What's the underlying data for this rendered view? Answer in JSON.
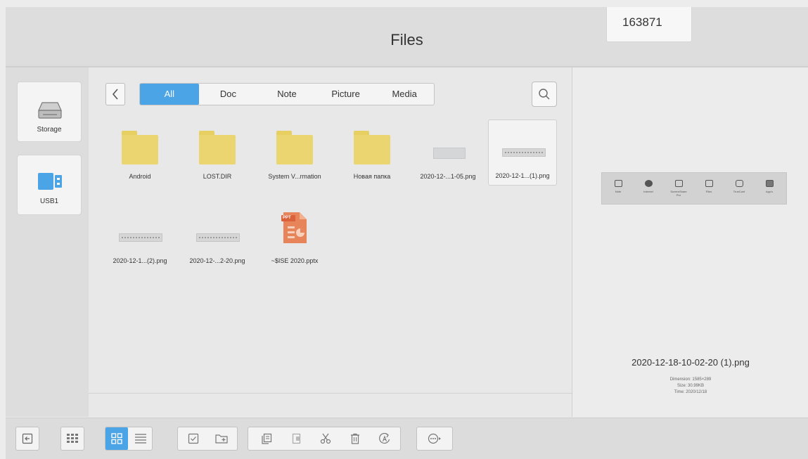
{
  "header": {
    "title": "Files",
    "badge": "163871"
  },
  "sidebar": {
    "devices": [
      {
        "label": "Storage"
      },
      {
        "label": "USB1"
      }
    ]
  },
  "filter": {
    "tabs": [
      "All",
      "Doc",
      "Note",
      "Picture",
      "Media"
    ],
    "active": "All"
  },
  "files": [
    {
      "name": "Android",
      "kind": "folder"
    },
    {
      "name": "LOST.DIR",
      "kind": "folder"
    },
    {
      "name": "System V...rmation",
      "kind": "folder"
    },
    {
      "name": "Новая папка",
      "kind": "folder"
    },
    {
      "name": "2020-12-...1-05.png",
      "kind": "image"
    },
    {
      "name": "2020-12-1...(1).png",
      "kind": "image",
      "selected": true
    },
    {
      "name": "2020-12-1...(2).png",
      "kind": "image"
    },
    {
      "name": "2020-12-...2-20.png",
      "kind": "image"
    },
    {
      "name": "~$ISE 2020.pptx",
      "kind": "ppt",
      "badge": "PPT"
    }
  ],
  "preview": {
    "filename": "2020-12-18-10-02-20 (1).png",
    "dimension": "Dimension: 1585×289",
    "size": "Size: 30.99KB",
    "time": "Time: 2020/12/18",
    "icons": [
      {
        "label": "Note",
        "icon": "board-icon"
      },
      {
        "label": "Internet",
        "icon": "globe-icon"
      },
      {
        "label": "ScreenShare Pro",
        "icon": "cast-icon"
      },
      {
        "label": "Files",
        "icon": "folder-icon"
      },
      {
        "label": "TrueConf",
        "icon": "conference-icon"
      },
      {
        "label": "App's",
        "icon": "apps-icon"
      }
    ]
  },
  "colors": {
    "accent": "#4aa4e6",
    "folder": "#ebd571",
    "ppt": "#e8845a"
  }
}
